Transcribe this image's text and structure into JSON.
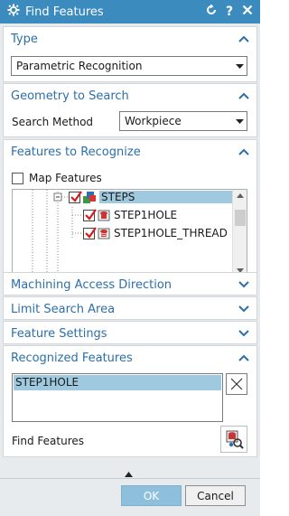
{
  "window": {
    "title": "Find Features",
    "title_color": "#3b8bbf"
  },
  "sections": {
    "type": {
      "label": "Type",
      "dropdown_value": "Parametric Recognition"
    },
    "geometry": {
      "label": "Geometry to Search",
      "method_label": "Search Method",
      "method_value": "Workpiece"
    },
    "features_to_recognize": {
      "label": "Features to Recognize",
      "map_features_label": "Map Features",
      "tree_items": [
        {
          "label": "STEPS",
          "checked": true,
          "selected": true
        },
        {
          "label": "STEP1HOLE",
          "checked": true,
          "selected": false
        },
        {
          "label": "STEP1HOLE_THREAD",
          "checked": true,
          "selected": false
        }
      ]
    },
    "machining_access": {
      "label": "Machining Access Direction"
    },
    "limit_search": {
      "label": "Limit Search Area"
    },
    "feature_settings": {
      "label": "Feature Settings"
    },
    "recognized": {
      "label": "Recognized Features",
      "items": [
        "STEP1HOLE"
      ],
      "find_label": "Find Features"
    }
  },
  "footer": {
    "ok_label": "OK",
    "cancel_label": "Cancel"
  },
  "colors": {
    "accent": "#2c6fa8",
    "selection": "#9fc9df",
    "ok_button": "#8ec0dc"
  }
}
